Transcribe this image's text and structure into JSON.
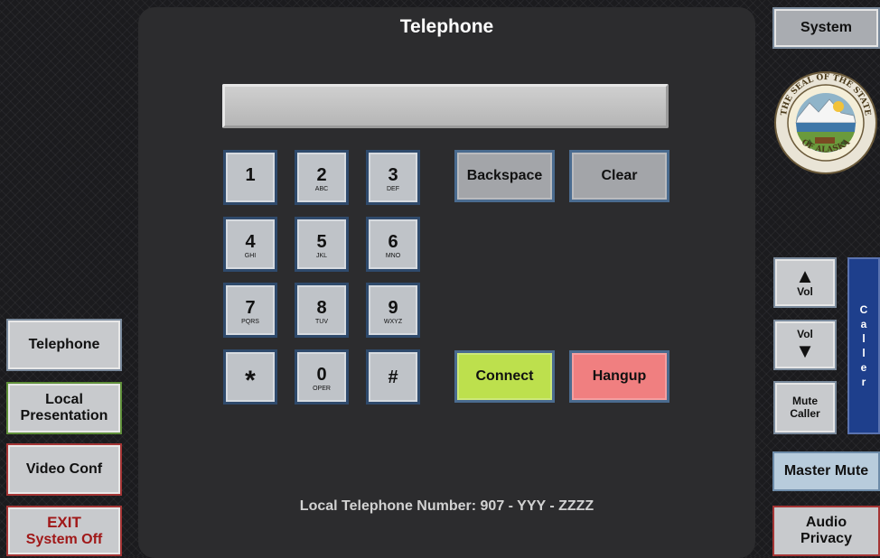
{
  "title": "Telephone",
  "dial_display": {
    "value": ""
  },
  "keypad": {
    "keys": [
      {
        "digit": "1",
        "letters": ""
      },
      {
        "digit": "2",
        "letters": "ABC"
      },
      {
        "digit": "3",
        "letters": "DEF"
      },
      {
        "digit": "4",
        "letters": "GHI"
      },
      {
        "digit": "5",
        "letters": "JKL"
      },
      {
        "digit": "6",
        "letters": "MNO"
      },
      {
        "digit": "7",
        "letters": "PQRS"
      },
      {
        "digit": "8",
        "letters": "TUV"
      },
      {
        "digit": "9",
        "letters": "WXYZ"
      },
      {
        "digit": "*",
        "letters": ""
      },
      {
        "digit": "0",
        "letters": "OPER"
      },
      {
        "digit": "#",
        "letters": ""
      }
    ]
  },
  "actions": {
    "backspace": "Backspace",
    "clear": "Clear",
    "connect": "Connect",
    "hangup": "Hangup"
  },
  "left_nav": {
    "telephone": "Telephone",
    "local_presentation_line1": "Local",
    "local_presentation_line2": "Presentation",
    "video_conf": "Video Conf",
    "exit_line1": "EXIT",
    "exit_line2": "System Off"
  },
  "right_panel": {
    "system": "System",
    "seal_text_top": "THE SEAL OF THE STATE",
    "seal_text_bottom": "OF ALASKA",
    "vol_up_label": "Vol",
    "vol_down_label": "Vol",
    "mute_caller_line1": "Mute",
    "mute_caller_line2": "Caller",
    "caller_letters": [
      "C",
      "a",
      "l",
      "l",
      "e",
      "r"
    ],
    "master_mute": "Master Mute",
    "audio_privacy_line1": "Audio",
    "audio_privacy_line2": "Privacy"
  },
  "footer": {
    "local_number": "Local Telephone Number: 907 - YYY - ZZZZ"
  },
  "colors": {
    "panel": "#2c2c2e",
    "connect": "#bde04d",
    "hangup": "#f07f80",
    "caller_bar": "#1e3f8c",
    "exit_text": "#a01818"
  }
}
